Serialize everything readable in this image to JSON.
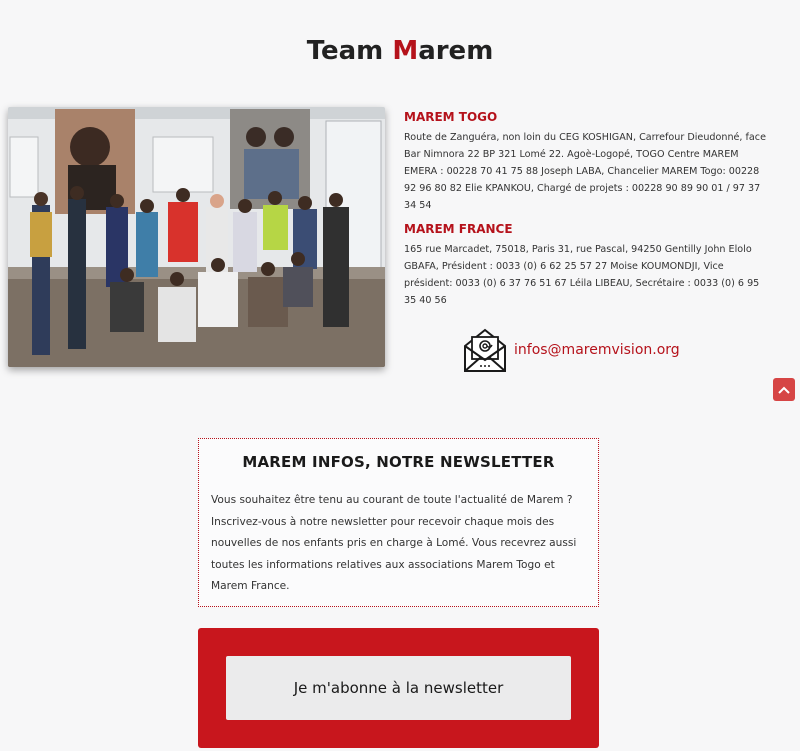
{
  "header": {
    "title_part1": "Team ",
    "title_part2": "M",
    "title_part3": "arem"
  },
  "contact": {
    "togo": {
      "heading": "MAREM TOGO",
      "text": "Route de Zanguéra, non loin du CEG KOSHIGAN, Carrefour Dieudonné, face Bar Nimnora 22 BP 321 Lomé 22. Agoè-Logopé, TOGO Centre MAREM EMERA : 00228 70 41 75 88 Joseph LABA, Chancelier MAREM Togo: 00228 92 96 80 82 Elie KPANKOU, Chargé de projets : 00228 90 89 90 01 / 97 37 34 54"
    },
    "france": {
      "heading": "MAREM FRANCE",
      "text": "165 rue Marcadet, 75018, Paris 31, rue Pascal, 94250 Gentilly John Elolo GBAFA, Président : 0033 (0) 6 62 25 57 27 Moise KOUMONDJI, Vice président: 0033 (0) 6 37 76 51 67 Léila LIBEAU, Secrétaire : 0033 (0) 6 95 35 40 56"
    },
    "email": "infos@maremvision.org"
  },
  "newsletter": {
    "heading": "MAREM INFOS, NOTRE NEWSLETTER",
    "body": "Vous souhaitez être tenu au courant de toute l'actualité de Marem ? Inscrivez-vous à notre newsletter pour recevoir chaque mois des nouvelles de nos enfants pris en charge à Lomé. Vous recevrez aussi toutes les informations relatives aux associations Marem Togo et Marem France.",
    "button_label": "Je m'abonne à la newsletter"
  },
  "icons": {
    "email": "envelope-at-icon",
    "scroll_top": "chevron-up-icon"
  },
  "colors": {
    "accent": "#b5121b",
    "band": "#c8161d",
    "button_bg": "#ebebec"
  }
}
